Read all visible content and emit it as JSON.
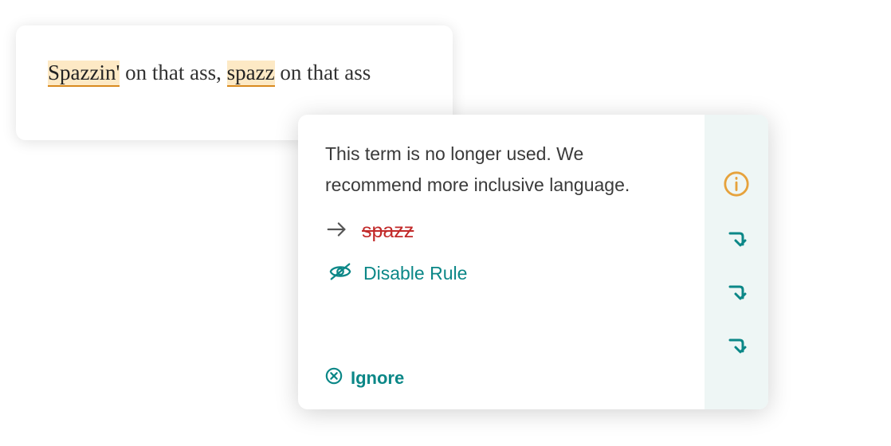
{
  "source_text": {
    "word1_highlighted": "Spazzin'",
    "between1": " on that ass, ",
    "word2_highlighted": "spazz",
    "after": " on that ass"
  },
  "tooltip": {
    "message": "This term is no longer used. We recommend more inclusive language.",
    "flagged_term": "spazz",
    "disable_label": "Disable Rule",
    "ignore_label": "Ignore"
  }
}
